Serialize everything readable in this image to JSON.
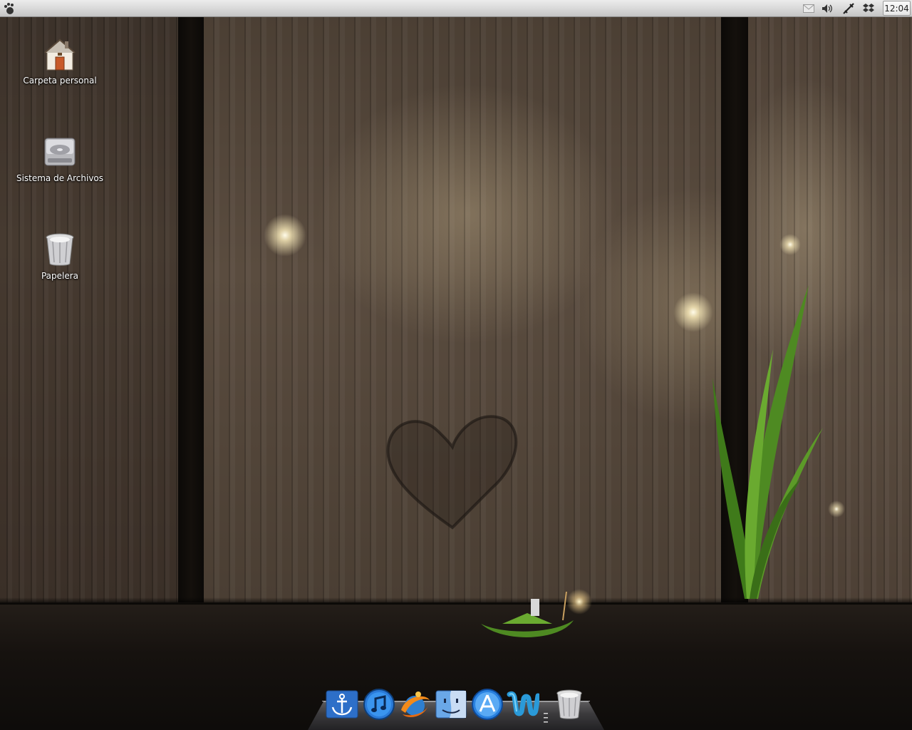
{
  "top_panel": {
    "menu_icon": "gnome-foot-icon",
    "tray_icons": [
      "mail-icon",
      "volume-icon",
      "network-icon",
      "dropbox-icon"
    ],
    "clock": "12:04"
  },
  "desktop": {
    "icons": [
      {
        "label": "Carpeta personal",
        "icon": "home-folder-icon"
      },
      {
        "label": "Sistema de Archivos",
        "icon": "hard-drive-icon"
      },
      {
        "label": "Papelera",
        "icon": "trash-icon"
      }
    ]
  },
  "dock": {
    "items": [
      "anchor-icon",
      "music-note-icon",
      "browser-swirl-icon",
      "finder-face-icon",
      "app-store-icon",
      "wave-app-icon",
      "trash-icon"
    ]
  },
  "colors": {
    "panel": "#d8d8d8",
    "wood": "#4a3e33",
    "glow": "#fffbe8"
  }
}
